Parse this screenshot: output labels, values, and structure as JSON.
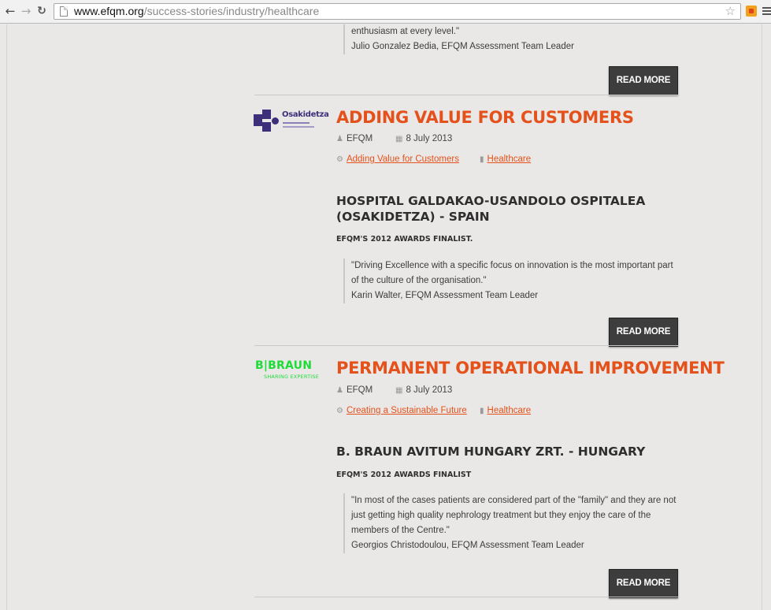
{
  "browser": {
    "url_host": "www.efqm.org",
    "url_path": "/success-stories/industry/healthcare"
  },
  "top_fragment": {
    "quote_end": "enthusiasm at every level.\"",
    "attribution": "Julio Gonzalez Bedia, EFQM Assessment Team Leader",
    "read_more": "READ MORE"
  },
  "posts": [
    {
      "logo": {
        "name": "Osakidetza",
        "icon": "osakidetza-logo",
        "color": "#3d2f7a"
      },
      "title": "ADDING VALUE FOR CUSTOMERS",
      "author": "EFQM",
      "date": "8 July 2013",
      "category": "Adding Value for Customers",
      "industry": "Healthcare",
      "heading": "HOSPITAL GALDAKAO-USANDOLO OSPITALEA (OSAKIDETZA) - SPAIN",
      "subheading": "EFQM'S 2012 AWARDS FINALIST.",
      "quote_lines": [
        "\"Driving Excellence with a specific focus on innovation is the most important part",
        "of the culture of the organisation.\""
      ],
      "attribution": "Karin Walter, EFQM Assessment Team Leader",
      "read_more": "READ MORE"
    },
    {
      "logo": {
        "name": "B|BRAUN",
        "tagline": "SHARING EXPERTISE",
        "icon": "bbraun-logo",
        "color": "#1ddc38"
      },
      "title": "PERMANENT OPERATIONAL IMPROVEMENT",
      "author": "EFQM",
      "date": "8 July 2013",
      "category": "Creating a Sustainable Future",
      "industry": "Healthcare",
      "heading": "B. BRAUN AVITUM HUNGARY ZRT.  - HUNGARY",
      "subheading": "EFQM'S 2012 AWARDS FINALIST",
      "quote_lines": [
        "\"In most of the cases patients are considered part of the \"family\" and they are not",
        "just getting high quality nephrology treatment but they enjoy the care of the",
        "members of the Centre.\""
      ],
      "attribution": "Georgios Christodoulou, EFQM Assessment Team Leader",
      "read_more": "READ MORE"
    }
  ],
  "colors": {
    "accent": "#e4511b",
    "background": "#e9e8e6",
    "button": "#3d3d3d"
  }
}
